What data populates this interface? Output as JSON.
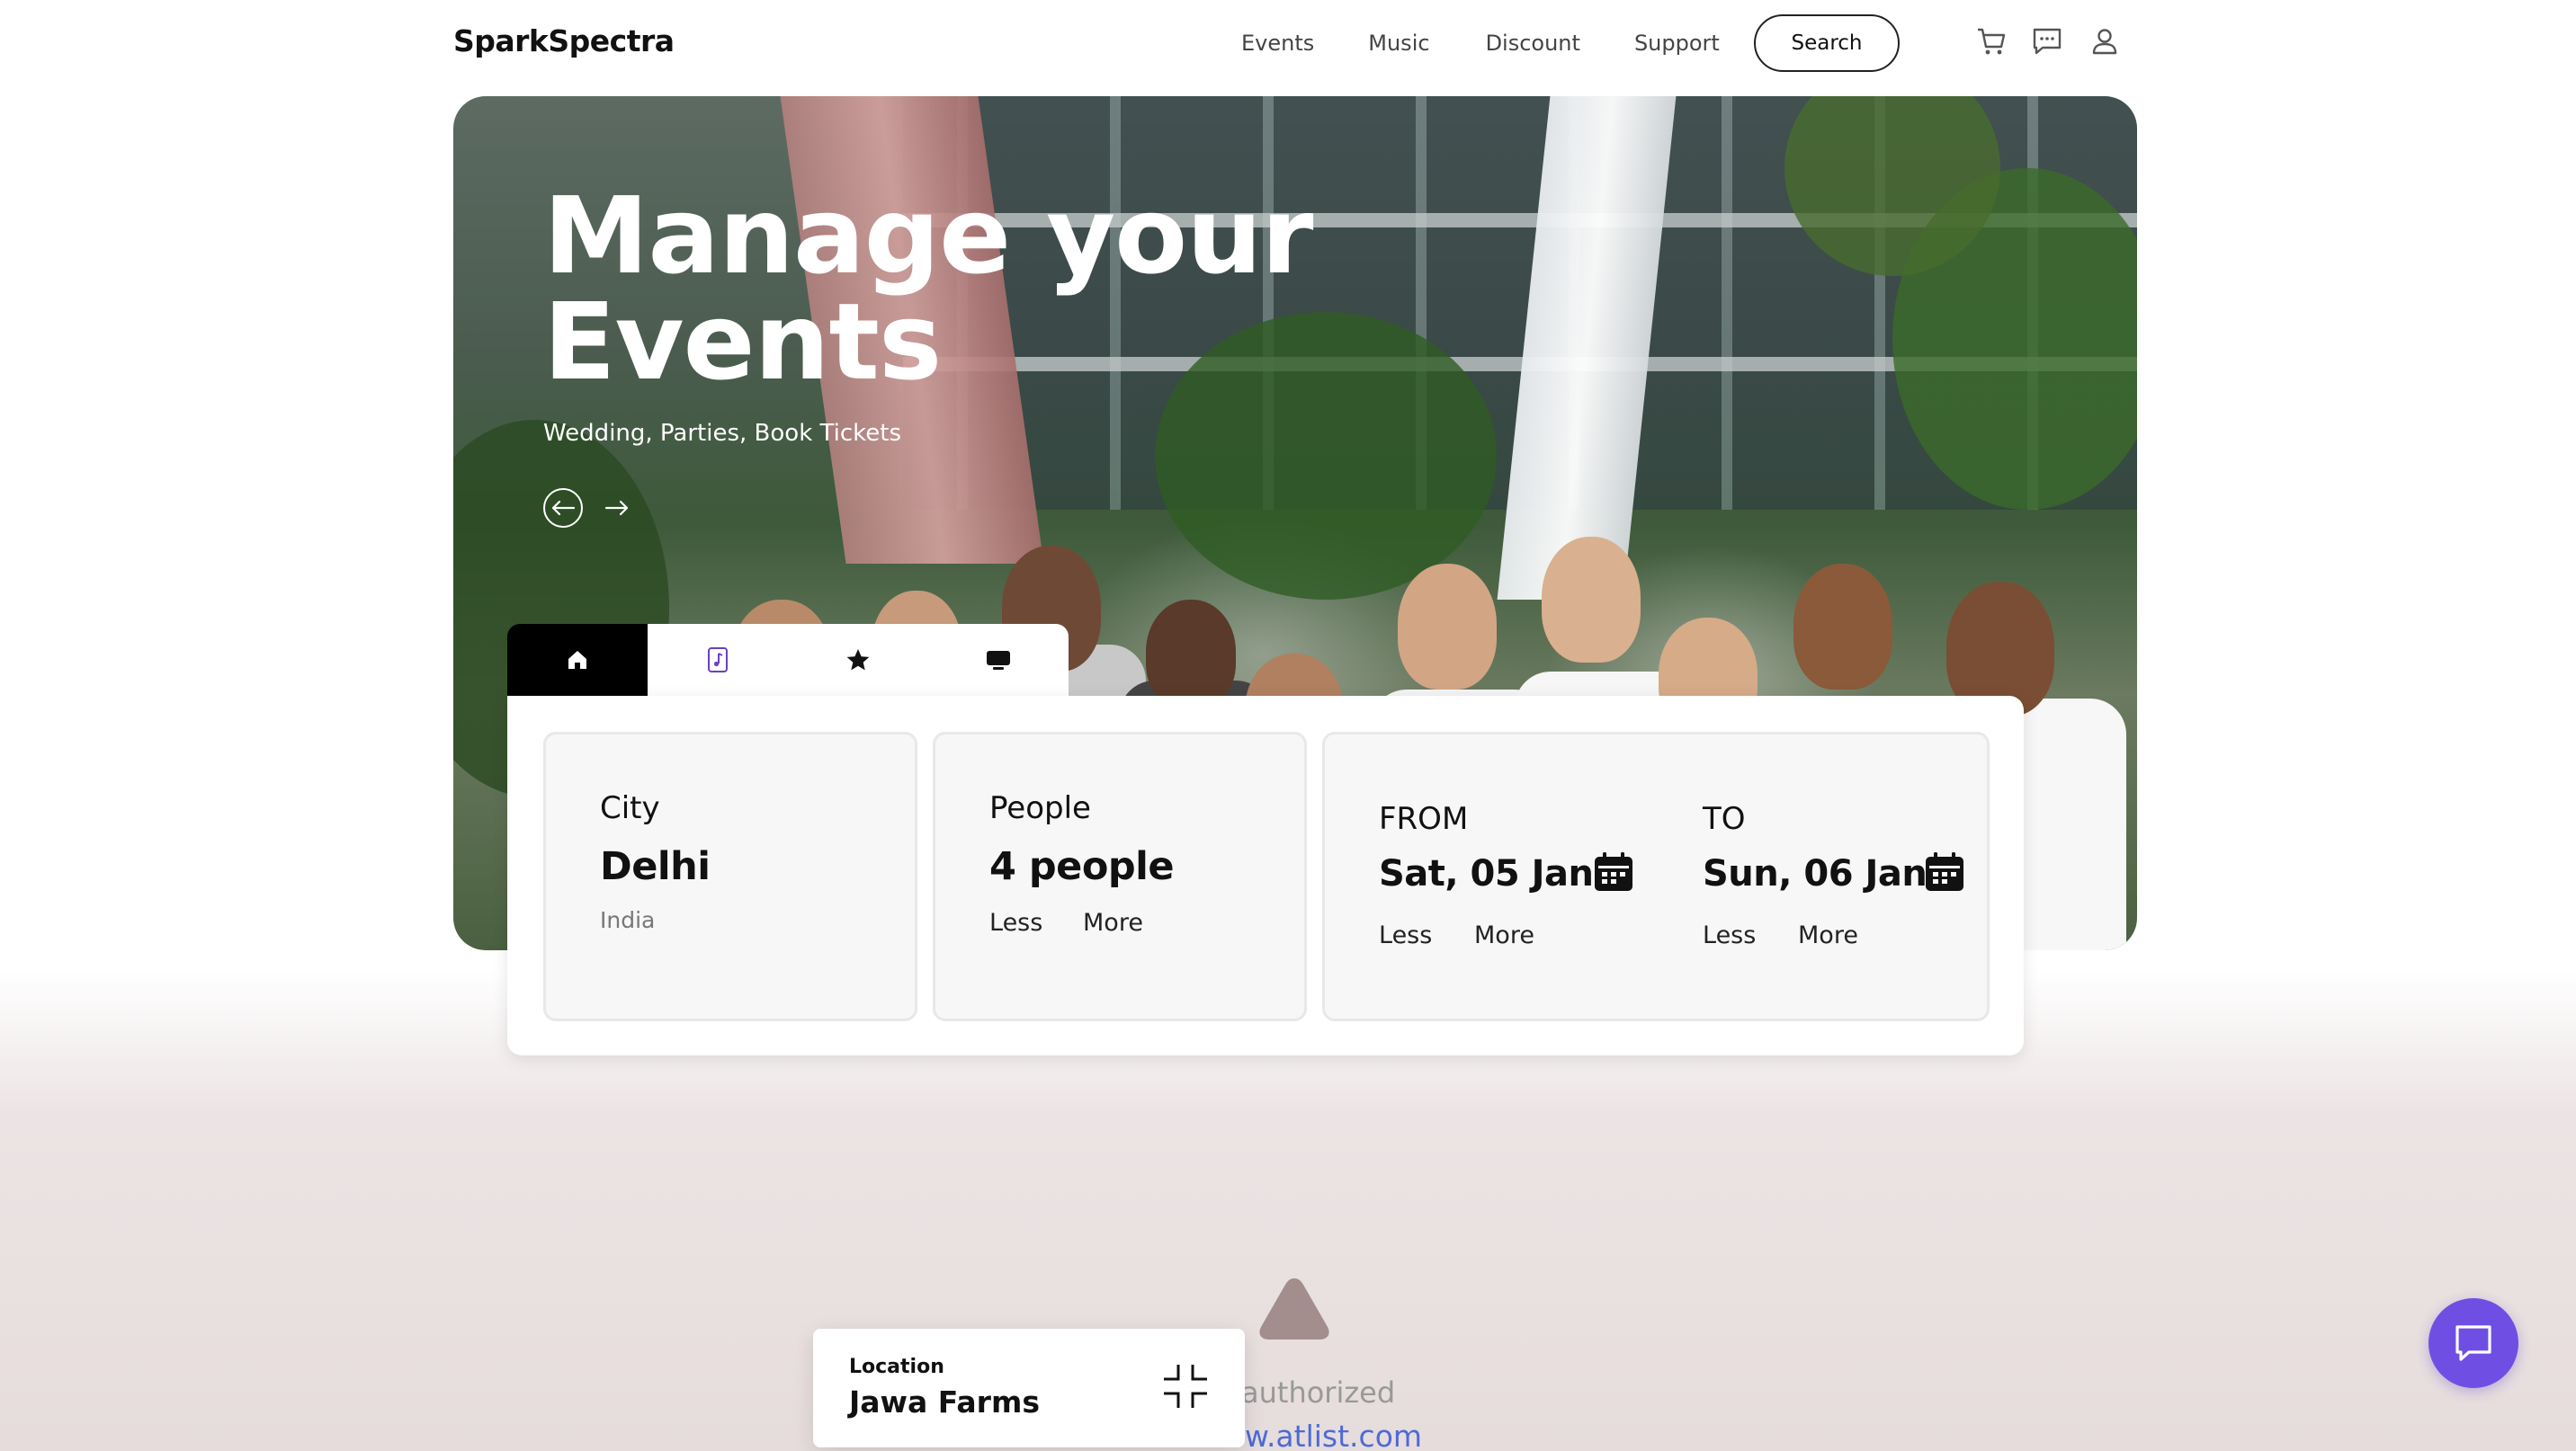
{
  "brand": {
    "logo": "SparkSpectra"
  },
  "nav": {
    "links": [
      "Events",
      "Music",
      "Discount",
      "Support"
    ],
    "search_label": "Search",
    "icons": [
      "cart-icon",
      "chat-bubble-icon",
      "user-icon"
    ]
  },
  "hero": {
    "title_line1": "Manage your",
    "title_line2": "Events",
    "subtitle": "Wedding, Parties, Book Tickets",
    "prev_icon": "arrow-left-icon",
    "next_icon": "arrow-right-icon"
  },
  "tabs": [
    {
      "icon": "home-icon",
      "active": true
    },
    {
      "icon": "music-note-icon",
      "active": false
    },
    {
      "icon": "star-icon",
      "active": false
    },
    {
      "icon": "monitor-icon",
      "active": false
    }
  ],
  "booking": {
    "city": {
      "label": "City",
      "value": "Delhi",
      "sub": "India"
    },
    "people": {
      "label": "People",
      "value": "4 people",
      "less": "Less",
      "more": "More"
    },
    "from": {
      "label": "FROM",
      "value": "Sat, 05 Jan",
      "less": "Less",
      "more": "More",
      "icon": "calendar-icon"
    },
    "to": {
      "label": "TO",
      "value": "Sun, 06 Jan",
      "less": "Less",
      "more": "More",
      "icon": "calendar-icon"
    }
  },
  "location_card": {
    "label": "Location",
    "value": "Jawa Farms",
    "icon": "collapse-icon"
  },
  "footer_overlay": {
    "authorized": "authorized",
    "link": "www.atlist.com"
  },
  "chat_fab": {
    "icon": "chat-icon"
  },
  "colors": {
    "accent": "#6f4fe3",
    "link": "#4d6bd6",
    "dark": "#000000",
    "panel_bg": "#f7f7f7"
  }
}
